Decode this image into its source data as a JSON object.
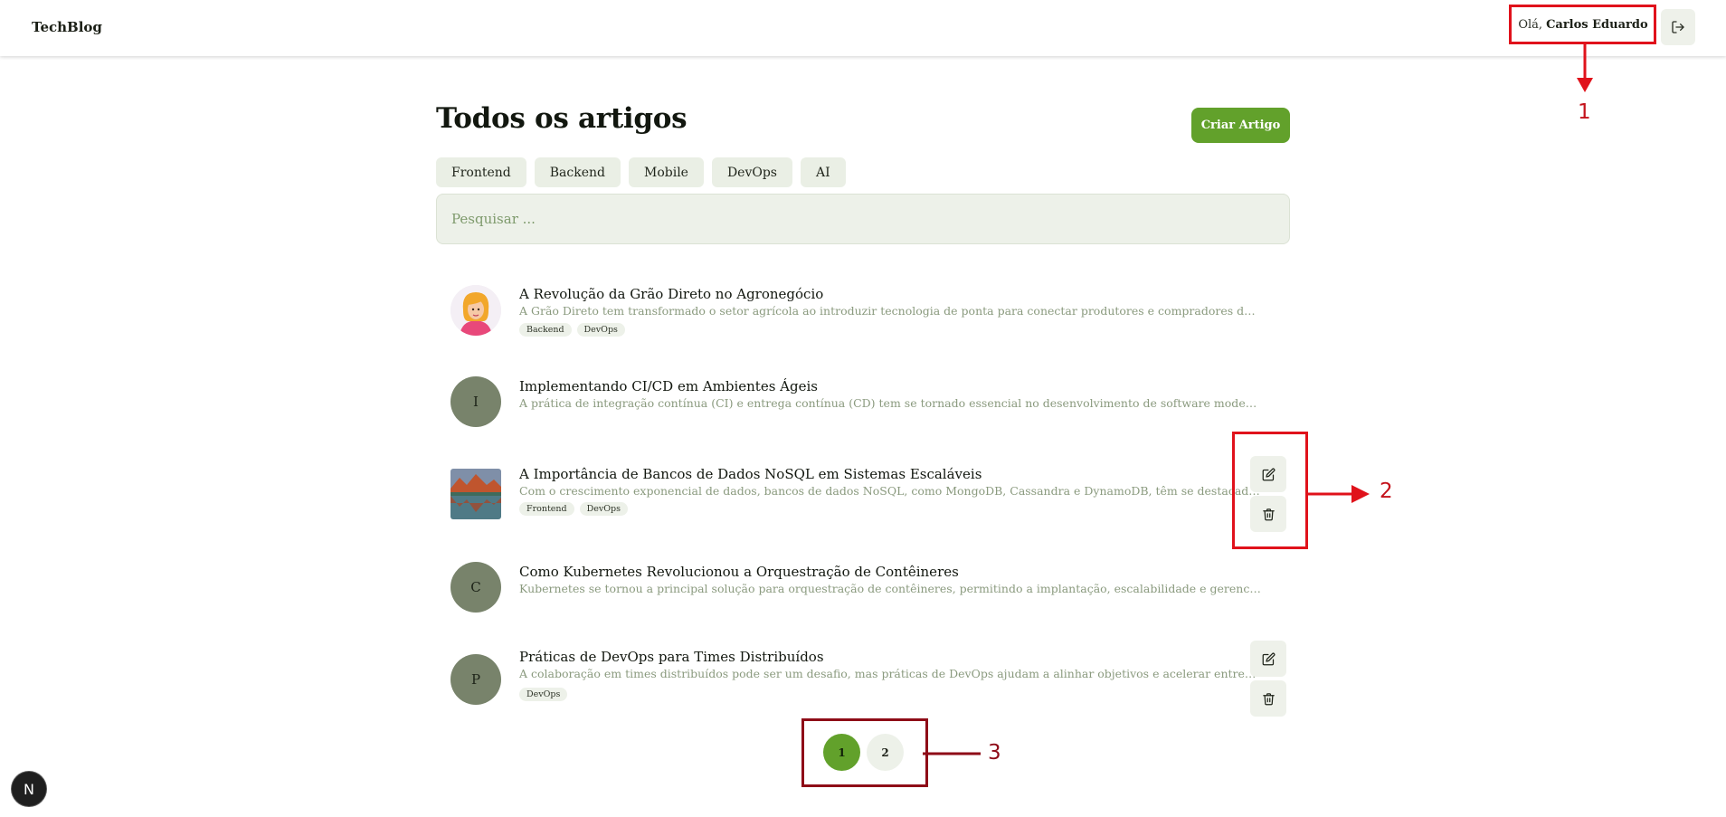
{
  "header": {
    "logo": "TechBlog",
    "greeting_prefix": "Olá,",
    "user_name": "Carlos Eduardo",
    "logout_icon": "logout-icon"
  },
  "main": {
    "title": "Todos os artigos",
    "create_button": "Criar Artigo",
    "categories": [
      "Frontend",
      "Backend",
      "Mobile",
      "DevOps",
      "AI"
    ],
    "search_placeholder": "Pesquisar ..."
  },
  "articles": [
    {
      "title": "A Revolução da Grão Direto no Agronegócio",
      "excerpt": "A Grão Direto tem transformado o setor agrícola ao introduzir tecnologia de ponta para conectar produtores e compradores de grãos. A...",
      "tags": [
        "Backend",
        "DevOps"
      ],
      "avatar": "illustrated-avatar-image"
    },
    {
      "title": "Implementando CI/CD em Ambientes Ágeis",
      "excerpt": "A prática de integração contínua (CI) e entrega contínua (CD) tem se tornado essencial no desenvolvimento de software moderno....",
      "tags": [],
      "avatar_letter": "I"
    },
    {
      "title": "A Importância de Bancos de Dados NoSQL em Sistemas Escaláveis",
      "excerpt": "Com o crescimento exponencial de dados, bancos de dados NoSQL, como MongoDB, Cassandra e DynamoDB, têm se destacado por...",
      "tags": [
        "Frontend",
        "DevOps"
      ],
      "avatar": "landscape-photo-image",
      "actions": [
        "edit-icon",
        "trash-icon"
      ]
    },
    {
      "title": "Como Kubernetes Revolucionou a Orquestração de Contêineres",
      "excerpt": "Kubernetes se tornou a principal solução para orquestração de contêineres, permitindo a implantação, escalabilidade e gerenciamento de...",
      "tags": [],
      "avatar_letter": "C"
    },
    {
      "title": "Práticas de DevOps para Times Distribuídos",
      "excerpt": "A colaboração em times distribuídos pode ser um desafio, mas práticas de DevOps ajudam a alinhar objetivos e acelerar entregas....",
      "tags": [
        "DevOps"
      ],
      "avatar_letter": "P",
      "actions": [
        "edit-icon",
        "trash-icon"
      ]
    }
  ],
  "pagination": {
    "pages": [
      "1",
      "2"
    ],
    "current": "1"
  },
  "annotations": {
    "one": "1",
    "two": "2",
    "three": "3"
  },
  "colors": {
    "accent": "#62a12b",
    "annotation_red": "#e0121b",
    "annotation_dark": "#8e0b17"
  },
  "badge": {
    "letter": "N"
  }
}
